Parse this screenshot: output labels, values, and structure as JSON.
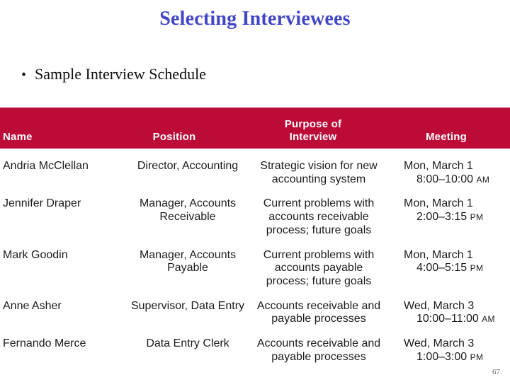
{
  "slide": {
    "title": "Selecting Interviewees",
    "title_color": "#4146c8",
    "bullet_marker": "•",
    "bullet_text": "Sample Interview Schedule",
    "page_number": "67"
  },
  "table": {
    "header_background": "#bd0b38",
    "header_text_color": "#ffffff",
    "columns": [
      {
        "label": "Name"
      },
      {
        "label": "Position"
      },
      {
        "label_line1": "Purpose of",
        "label_line2": "Interview"
      },
      {
        "label": "Meeting"
      }
    ],
    "rows": [
      {
        "name": "Andria McClellan",
        "position_line1": "Director, Accounting",
        "position_line2": "",
        "purpose_line1": "Strategic vision for new",
        "purpose_line2": "accounting system",
        "purpose_line3": "",
        "meeting_date": "Mon, March 1",
        "meeting_time": "8:00–10:00",
        "meeting_ampm": "AM"
      },
      {
        "name": "Jennifer Draper",
        "position_line1": "Manager, Accounts",
        "position_line2": "Receivable",
        "purpose_line1": "Current problems with",
        "purpose_line2": "accounts receivable",
        "purpose_line3": "process; future goals",
        "meeting_date": "Mon, March 1",
        "meeting_time": "2:00–3:15",
        "meeting_ampm": "PM"
      },
      {
        "name": "Mark Goodin",
        "position_line1": "Manager, Accounts",
        "position_line2": "Payable",
        "purpose_line1": "Current problems with",
        "purpose_line2": "accounts payable",
        "purpose_line3": "process; future goals",
        "meeting_date": "Mon, March 1",
        "meeting_time": "4:00–5:15",
        "meeting_ampm": "PM"
      },
      {
        "name": "Anne Asher",
        "position_line1": "Supervisor, Data Entry",
        "position_line2": "",
        "purpose_line1": "Accounts receivable and",
        "purpose_line2": "payable processes",
        "purpose_line3": "",
        "meeting_date": "Wed, March 3",
        "meeting_time": "10:00–11:00",
        "meeting_ampm": "AM"
      },
      {
        "name": "Fernando Merce",
        "position_line1": "Data Entry Clerk",
        "position_line2": "",
        "purpose_line1": "Accounts receivable and",
        "purpose_line2": "payable processes",
        "purpose_line3": "",
        "meeting_date": "Wed, March 3",
        "meeting_time": "1:00–3:00",
        "meeting_ampm": "PM"
      }
    ]
  }
}
